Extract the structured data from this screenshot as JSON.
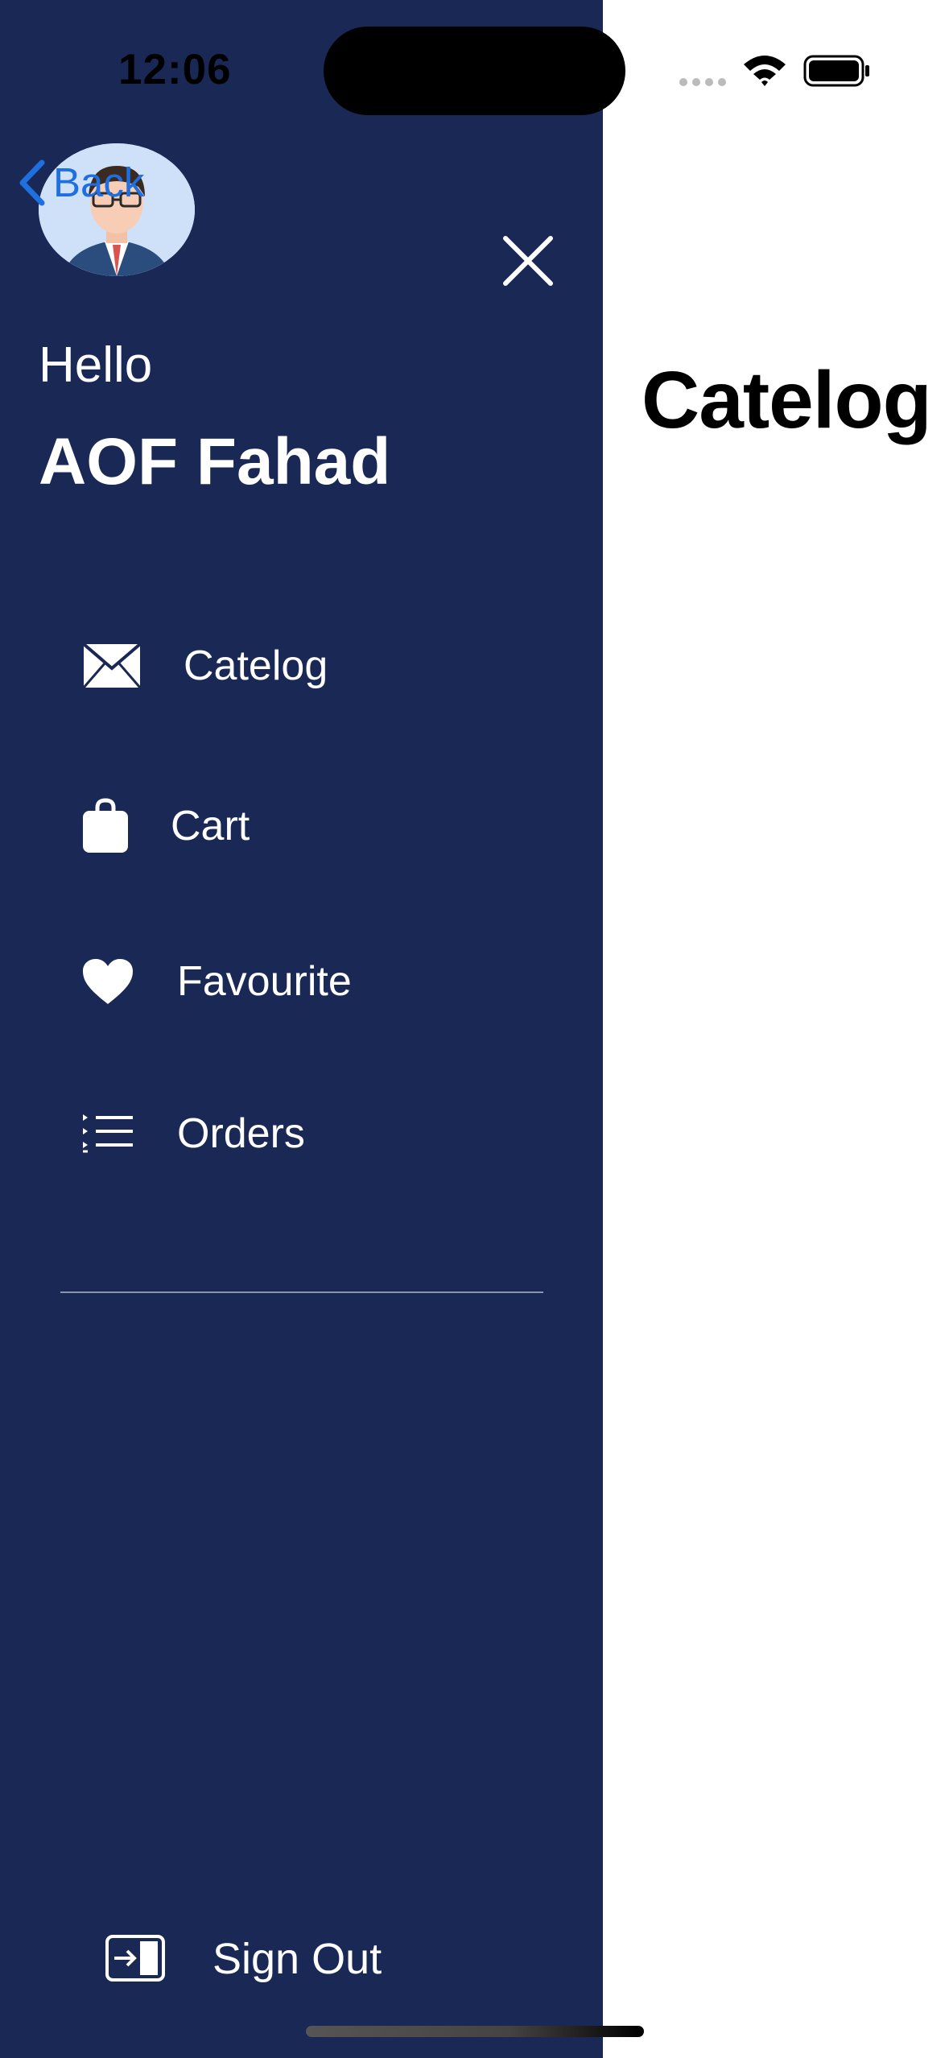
{
  "status_bar": {
    "time": "12:06"
  },
  "nav": {
    "back_label": "Back"
  },
  "drawer": {
    "greeting": "Hello",
    "user_name": "AOF Fahad",
    "menu": [
      {
        "label": "Catelog",
        "icon": "envelope-icon"
      },
      {
        "label": "Cart",
        "icon": "shopping-bag-icon"
      },
      {
        "label": "Favourite",
        "icon": "heart-icon"
      },
      {
        "label": "Orders",
        "icon": "list-icon"
      }
    ],
    "sign_out_label": "Sign Out"
  },
  "main": {
    "title": "Catelog"
  },
  "colors": {
    "drawer_bg": "#1a2855",
    "back_blue": "#1e6fe0"
  }
}
